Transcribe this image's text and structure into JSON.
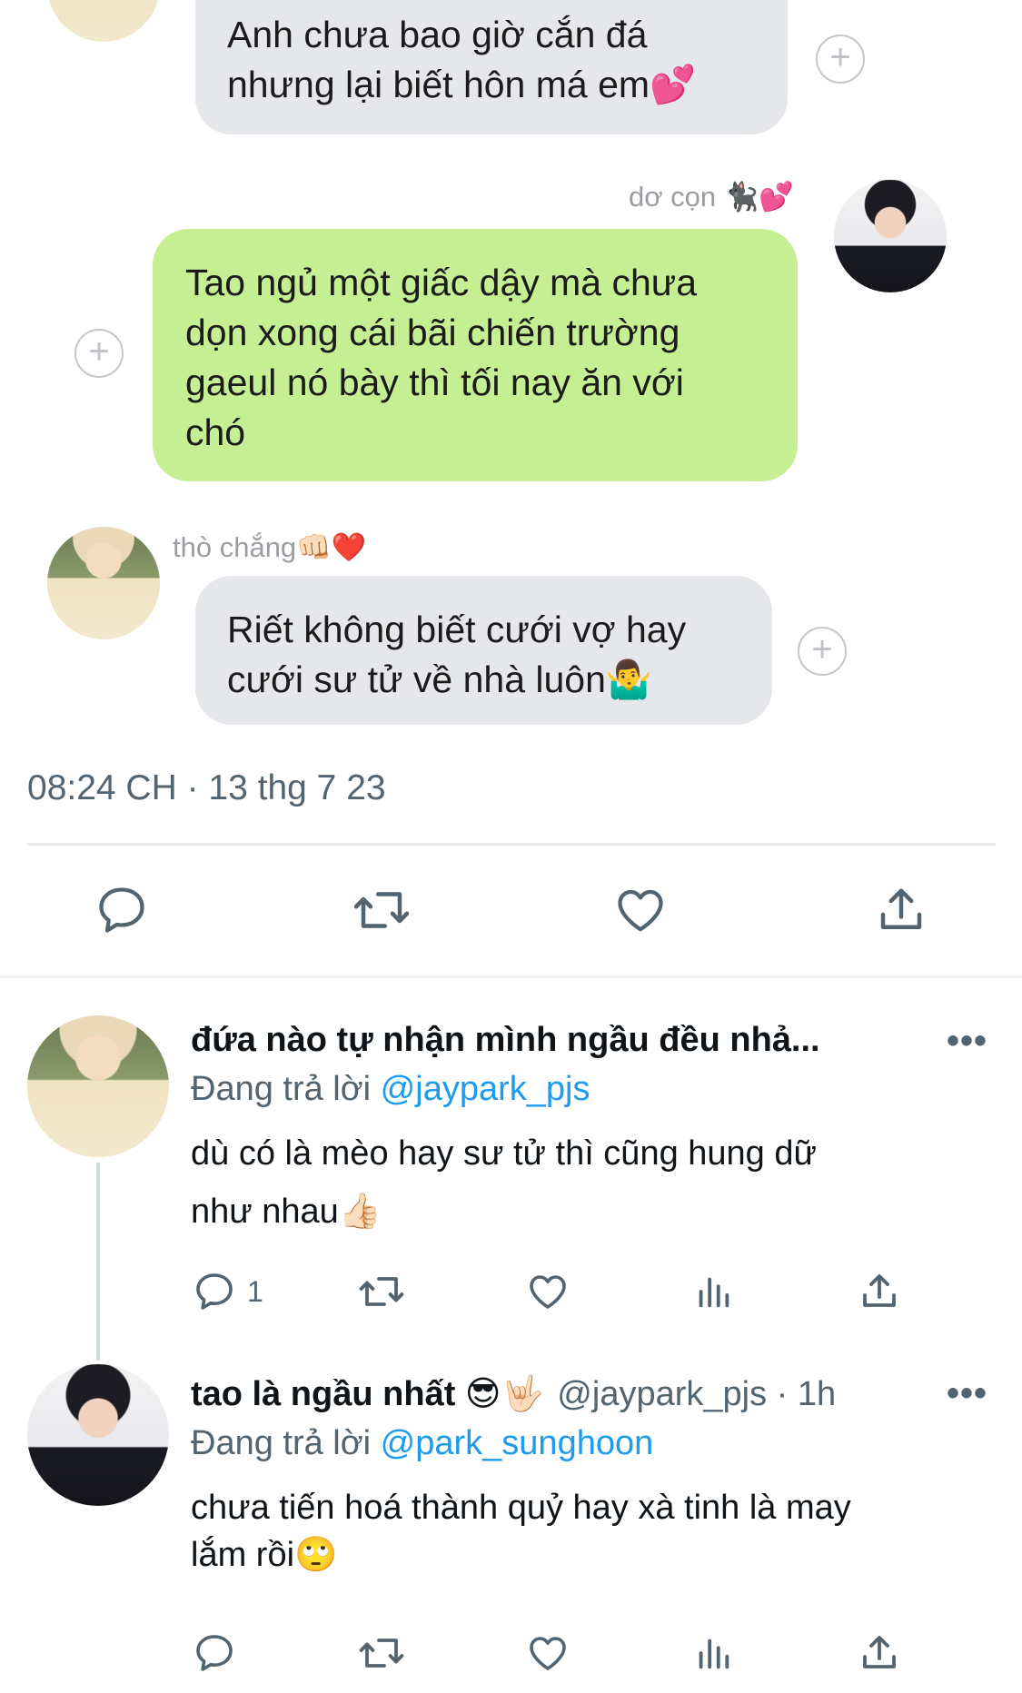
{
  "chat": {
    "msg1": {
      "line1": "Anh chưa bao giờ cắn đá",
      "line2": "nhưng lại biết hôn má em💕"
    },
    "msg2": {
      "sender": "dơ cọn 🐈‍⬛💕",
      "lines": [
        "Tao ngủ một giấc dậy mà chưa",
        "dọn xong cái bãi chiến trường",
        "gaeul nó bày thì tối nay ăn với",
        "chó"
      ]
    },
    "msg3": {
      "sender": "thò chắng👊🏻❤️",
      "line1": "Riết không biết cưới vợ hay",
      "line2": "cưới sư tử về nhà luôn🤷‍♂️"
    }
  },
  "tweet_meta": "08:24 CH · 13 thg 7 23",
  "replies": [
    {
      "name": "đứa nào tự nhận mình ngầu đều nhả...",
      "replying_prefix": "Đang trả lời",
      "replying_to": "@jaypark_pjs",
      "line1": "dù có là mèo hay sư tử thì cũng hung dữ",
      "line2": "như nhau👍🏻",
      "reply_count": "1",
      "more": "•••"
    },
    {
      "name": "tao là ngầu nhất 😎🤟🏻",
      "handle_time": "@jaypark_pjs · 1h",
      "replying_prefix": "Đang trả lời",
      "replying_to": "@park_sunghoon",
      "line1": "chưa tiến hoá thành quỷ hay xà tinh là may",
      "line2": "lắm rồi🙄",
      "more": "•••"
    }
  ],
  "colors": {
    "accent": "#1d9bf0",
    "green_bubble": "#c6ef94",
    "gray_bubble": "#e6e7ea"
  },
  "icons": [
    "plus-icon",
    "reply-icon",
    "retweet-icon",
    "like-icon",
    "share-icon",
    "views-icon",
    "more-icon"
  ]
}
